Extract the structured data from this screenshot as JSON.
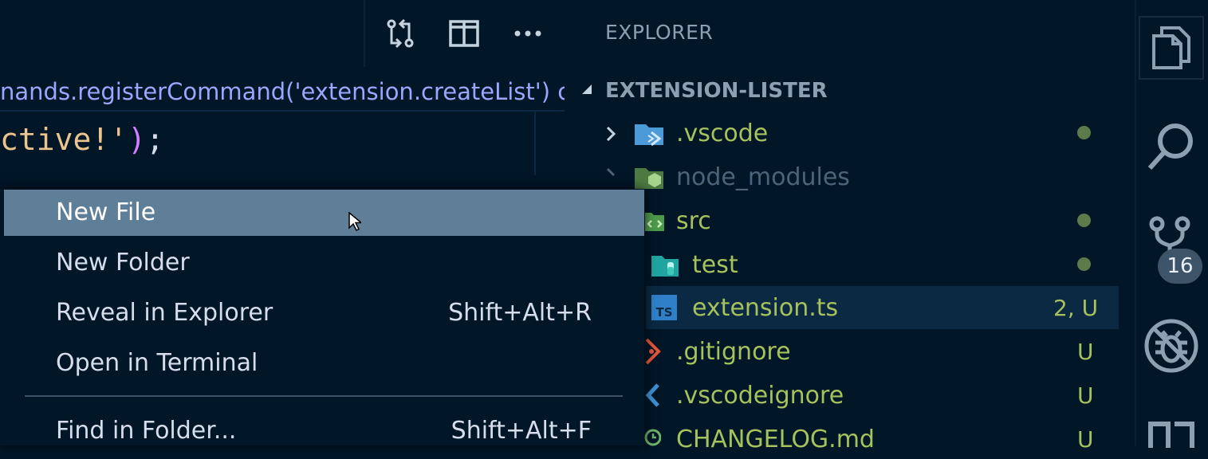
{
  "editor": {
    "breadcrumb": "nands.registerCommand('extension.createList') call",
    "code_line": {
      "text_a": "ctive!'",
      "paren": ")",
      "semicolon": ";"
    },
    "toolbar": {
      "compare_icon": "compare-changes-icon",
      "split_icon": "split-editor-icon",
      "more_icon": "more-actions-icon"
    }
  },
  "context_menu": {
    "items": [
      {
        "label": "New File",
        "shortcut": "",
        "highlighted": true
      },
      {
        "label": "New Folder",
        "shortcut": ""
      },
      {
        "label": "Reveal in Explorer",
        "shortcut": "Shift+Alt+R"
      },
      {
        "label": "Open in Terminal",
        "shortcut": ""
      },
      {
        "label": "Find in Folder...",
        "shortcut": "Shift+Alt+F"
      }
    ]
  },
  "explorer": {
    "title": "EXPLORER",
    "workspace": "EXTENSION-LISTER",
    "files": [
      {
        "name": ".vscode",
        "icon": "vscode-folder-icon",
        "status": "dot"
      },
      {
        "name": "node_modules",
        "icon": "node-folder-icon",
        "status": ""
      },
      {
        "name": "src",
        "icon": "src-folder-icon",
        "status": "dot"
      },
      {
        "name": "test",
        "icon": "test-folder-icon",
        "status": "dot"
      },
      {
        "name": "extension.ts",
        "icon": "typescript-file-icon",
        "status": "2, U"
      },
      {
        "name": ".gitignore",
        "icon": "git-file-icon",
        "status": "U"
      },
      {
        "name": ".vscodeignore",
        "icon": "vscode-file-icon",
        "status": "U"
      },
      {
        "name": "CHANGELOG.md",
        "icon": "changelog-file-icon",
        "status": "U"
      }
    ]
  },
  "activity_bar": {
    "items": [
      "files-icon",
      "search-icon",
      "source-control-icon",
      "debug-icon",
      "extensions-icon"
    ],
    "scm_badge": "16"
  },
  "colors": {
    "background": "#011627",
    "menu_highlight": "#5f7e97",
    "git_untracked": "#a5c25c"
  }
}
